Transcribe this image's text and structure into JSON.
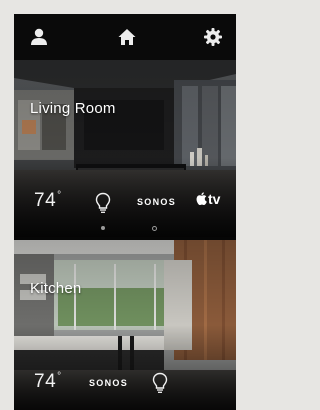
{
  "topbar": {
    "icons": [
      "user-icon",
      "home-icon",
      "gear-icon"
    ]
  },
  "rooms": [
    {
      "name": "Living Room",
      "temperature": "74",
      "temperature_unit": "°",
      "devices": [
        "light-bulb-icon",
        "SONOS",
        "tv"
      ],
      "sonos_label": "SONOS",
      "tv_label": "tv",
      "page_dots": 2,
      "active_dot": 1
    },
    {
      "name": "Kitchen",
      "temperature": "74",
      "temperature_unit": "°",
      "devices": [
        "SONOS",
        "light-bulb-icon"
      ],
      "sonos_label": "SONOS"
    }
  ],
  "colors": {
    "background": "#e7e6e3",
    "app_background": "#0c0c0c",
    "text": "#ffffff"
  }
}
